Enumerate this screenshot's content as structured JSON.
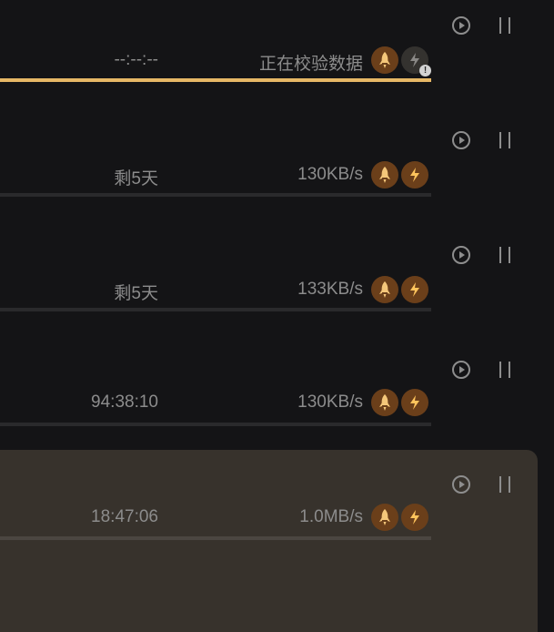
{
  "colors": {
    "page_background": "#141416",
    "selected_row_background": "#37322c",
    "progress_fill": "#e6b866",
    "badge_active": "#6b3f1a",
    "badge_inactive": "#34322f",
    "rocket_icon": "#f5c77a",
    "bolt_icon": "#ffc45c",
    "text_muted": "#8c8c8c"
  },
  "icons": {
    "play": "play-circle-icon",
    "pause": "pause-icon",
    "rocket": "rocket-icon",
    "bolt": "lightning-icon",
    "warning": "exclamation-icon"
  },
  "downloads": [
    {
      "time_left": "--:--:--",
      "status": "正在校验数据",
      "progress": 1.0,
      "bolt_enabled": false,
      "warning_glyph": "!",
      "selected": false
    },
    {
      "time_left": "剩5天",
      "status": "130KB/s",
      "progress": 0.0,
      "bolt_enabled": true,
      "selected": false
    },
    {
      "time_left": "剩5天",
      "status": "133KB/s",
      "progress": 0.0,
      "bolt_enabled": true,
      "selected": false
    },
    {
      "time_left": "94:38:10",
      "status": "130KB/s",
      "progress": 0.0,
      "bolt_enabled": true,
      "selected": false
    },
    {
      "time_left": "18:47:06",
      "status": "1.0MB/s",
      "progress": 0.0,
      "bolt_enabled": true,
      "selected": true
    }
  ]
}
